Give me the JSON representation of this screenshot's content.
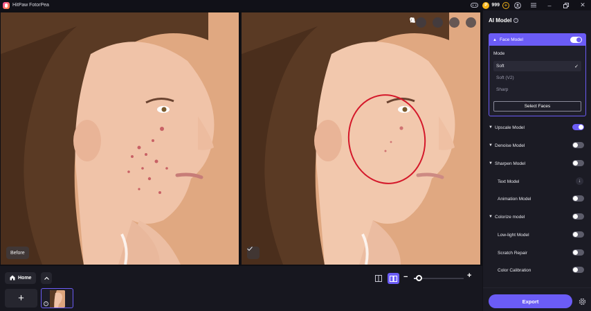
{
  "app": {
    "title": "HitPaw FotorPea"
  },
  "titlebar": {
    "coin_count": "999",
    "icons": [
      "gamepad-icon",
      "coin-icon",
      "add-credits-icon",
      "account-icon",
      "menu-icon",
      "minimize-icon",
      "restore-icon",
      "close-icon"
    ]
  },
  "canvas": {
    "before_label": "Before",
    "tools": [
      "thumbs-up-icon",
      "thumbs-down-icon",
      "zoom-icon",
      "crop-icon"
    ]
  },
  "bottom": {
    "home_label": "Home",
    "zoom_level": 0.05
  },
  "panel": {
    "title": "AI Model",
    "face_model": {
      "label": "Face Model",
      "enabled": true,
      "mode_label": "Mode",
      "modes": [
        "Soft",
        "Soft (V2)",
        "Sharp"
      ],
      "selected_mode": "Soft",
      "select_faces_label": "Select Faces"
    },
    "models": [
      {
        "label": "Upscale Model",
        "expandable": true,
        "enabled": true
      },
      {
        "label": "Denoise Model",
        "expandable": true,
        "enabled": false
      },
      {
        "label": "Sharpen Model",
        "expandable": true,
        "enabled": false
      },
      {
        "label": "Text Model",
        "expandable": false,
        "download": true
      },
      {
        "label": "Animation Model",
        "expandable": false,
        "enabled": false
      },
      {
        "label": "Colorize model",
        "expandable": true,
        "enabled": false
      },
      {
        "label": "Low-light Model",
        "expandable": false,
        "enabled": false
      },
      {
        "label": "Scratch Repair",
        "expandable": false,
        "enabled": false
      },
      {
        "label": "Color Calibration",
        "expandable": false,
        "enabled": false
      }
    ],
    "export_label": "Export"
  },
  "colors": {
    "accent": "#6b5cf6",
    "panel_bg": "#1b1b24",
    "annotation_circle": "#d4182a"
  }
}
